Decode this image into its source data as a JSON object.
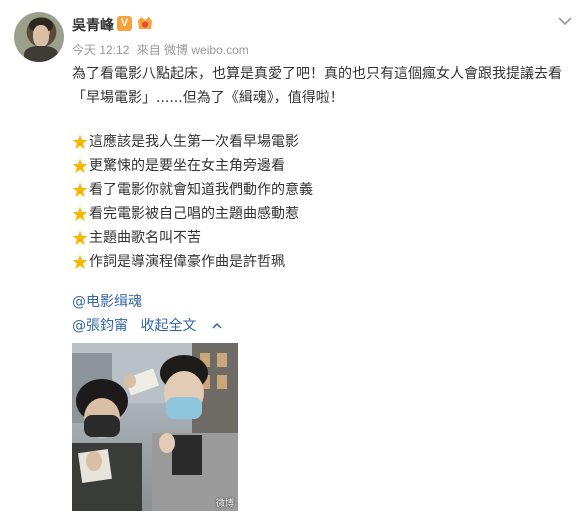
{
  "header": {
    "username": "吳青峰",
    "verified_badge": "V",
    "time": "今天 12:12",
    "source": "來自 微博 weibo.com"
  },
  "post": {
    "line1": "為了看電影八點起床，也算是真愛了吧！真的也只有這個瘋女人會跟我提議去看",
    "line2": "「早場電影」......但為了《緝魂》，值得啦！",
    "list": [
      "這應該是我人生第一次看早場電影",
      "更驚悚的是要坐在女主角旁邊看",
      "看了電影你就會知道我們動作的意義",
      "看完電影被自己唱的主題曲感動惹",
      "主題曲歌名叫不苦",
      "作詞是導演程偉豪作曲是許哲珮"
    ],
    "mention1": "@电影缉魂",
    "mention2": "@張鈞甯",
    "collapse_label": "收起全文"
  },
  "photo": {
    "watermark": "微博"
  },
  "colors": {
    "link": "#3366aa",
    "meta": "#999999",
    "star": "#f5b800",
    "badge": "#f7a13b"
  }
}
